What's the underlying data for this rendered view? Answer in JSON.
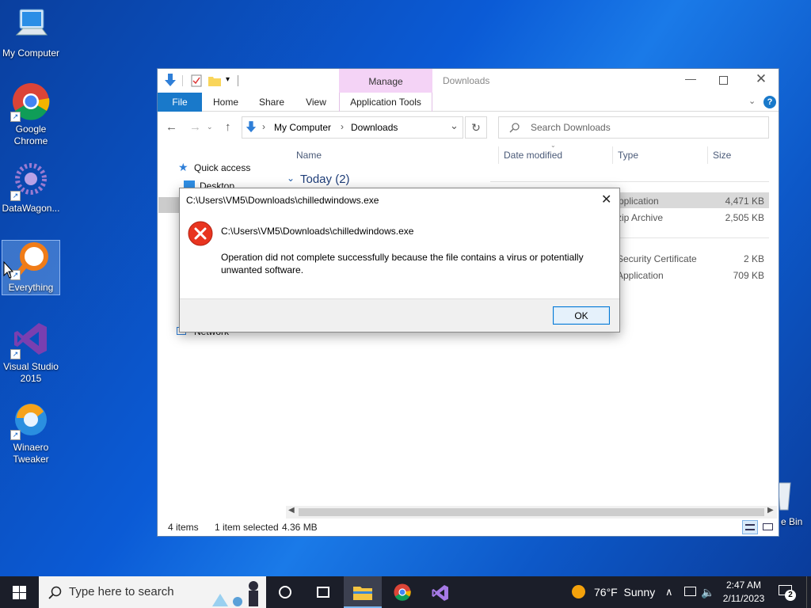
{
  "desktop": {
    "icons": [
      {
        "label": "My Computer"
      },
      {
        "label": "Google Chrome"
      },
      {
        "label": "DataWagon..."
      },
      {
        "label": "Everything"
      },
      {
        "label": "Visual Studio 2015"
      },
      {
        "label": "Winaero Tweaker"
      }
    ],
    "recycle_bin_label": "e Bin"
  },
  "explorer": {
    "window_title": "Downloads",
    "context_tab": "Manage",
    "tabs": [
      "File",
      "Home",
      "Share",
      "View",
      "Application Tools"
    ],
    "address": {
      "crumbs": [
        "My Computer",
        "Downloads"
      ]
    },
    "search_placeholder": "Search Downloads",
    "columns": [
      "Name",
      "Date modified",
      "Type",
      "Size"
    ],
    "nav": {
      "quick_access": "Quick access",
      "desktop": "Desktop",
      "network": "Network"
    },
    "group_header": "Today (2)",
    "rows": [
      {
        "type": "Application",
        "size": "4,471 KB"
      },
      {
        "type": "zip Archive",
        "size": "2,505 KB"
      },
      {
        "type": "Security Certificate",
        "size": "2 KB"
      },
      {
        "type": "Application",
        "size": "709 KB"
      }
    ],
    "status": {
      "items": "4 items",
      "selected": "1 item selected",
      "size": "4.36 MB"
    }
  },
  "dialog": {
    "title": "C:\\Users\\VM5\\Downloads\\chilledwindows.exe",
    "path": "C:\\Users\\VM5\\Downloads\\chilledwindows.exe",
    "message": "Operation did not complete successfully because the file contains a virus or potentially unwanted software.",
    "ok_label": "OK"
  },
  "taskbar": {
    "search_placeholder": "Type here to search",
    "weather": "76°F  Sunny",
    "time": "2:47 AM",
    "date": "2/11/2023",
    "notification_count": "2"
  },
  "colors": {
    "accent": "#0078d7",
    "manage_tab": "#f4d3f6",
    "error_red": "#e8341f"
  }
}
